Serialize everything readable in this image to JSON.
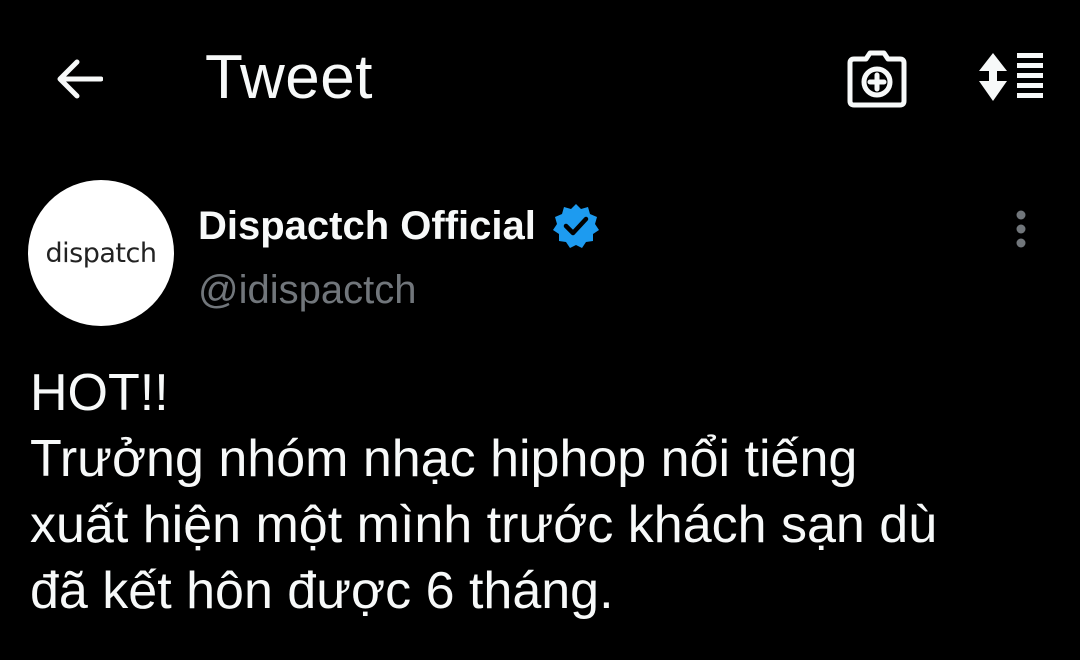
{
  "header": {
    "title": "Tweet",
    "back_icon": "arrow-left-icon",
    "camera_icon": "camera-plus-icon",
    "sort_icon": "sort-list-icon"
  },
  "author": {
    "avatar_text": "dispatch",
    "display_name": "Dispactch Official",
    "handle": "@idispactch",
    "verified_icon": "verified-badge-icon",
    "more_icon": "more-vertical-icon"
  },
  "tweet": {
    "lines": [
      "HOT!!",
      "Trưởng nhóm nhạc hiphop nổi tiếng",
      "xuất hiện một mình trước khách sạn dù",
      "đã kết hôn được 6 tháng."
    ]
  },
  "colors": {
    "background": "#000000",
    "text_primary": "#f7f9f9",
    "text_secondary": "#71767b",
    "verified_blue": "#1d9bf0"
  }
}
